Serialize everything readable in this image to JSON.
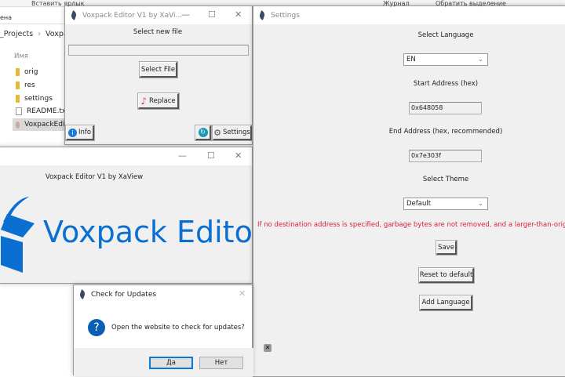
{
  "explorer": {
    "toolbar_paste_shortcut": "Вставить ярлык",
    "toolbar_journal": "Журнал",
    "toolbar_invert_selection": "Обратить выделение",
    "ribbon_partial": "ена",
    "breadcrumb": [
      "_Projects",
      "Voxpack"
    ],
    "column_name": "Имя",
    "files": [
      {
        "name": "orig",
        "type": "folder"
      },
      {
        "name": "res",
        "type": "folder"
      },
      {
        "name": "settings",
        "type": "folder"
      },
      {
        "name": "README.txt",
        "type": "text"
      },
      {
        "name": "VoxpackEdit",
        "type": "app",
        "selected": true
      }
    ]
  },
  "main_window": {
    "title": "Voxpack Editor V1 by XaVi...",
    "select_label": "Select new file",
    "file_path": "",
    "select_file": "Select File",
    "replace": "Replace",
    "info": "Info",
    "settings": "Settings"
  },
  "splash": {
    "subtitle": "Voxpack Editor V1 by XaView",
    "logo_text": "Voxpack Editor",
    "brand_color": "#0a6fd0"
  },
  "settings": {
    "title": "Settings",
    "language_label": "Select Language",
    "language_value": "EN",
    "start_label": "Start Address (hex)",
    "start_value": "0x648058",
    "end_label": "End Address (hex, recommended)",
    "end_value": "0x7e303f",
    "theme_label": "Select Theme",
    "theme_value": "Default",
    "warning": "If no destination address is specified, garbage bytes are not removed, and a larger-than-original my",
    "warning_color": "#e0203a",
    "save": "Save",
    "reset": "Reset to default",
    "add_language": "Add Language"
  },
  "update_dialog": {
    "title": "Check for Updates",
    "message": "Open the website to check for updates?",
    "yes": "Да",
    "no": "Нет"
  }
}
